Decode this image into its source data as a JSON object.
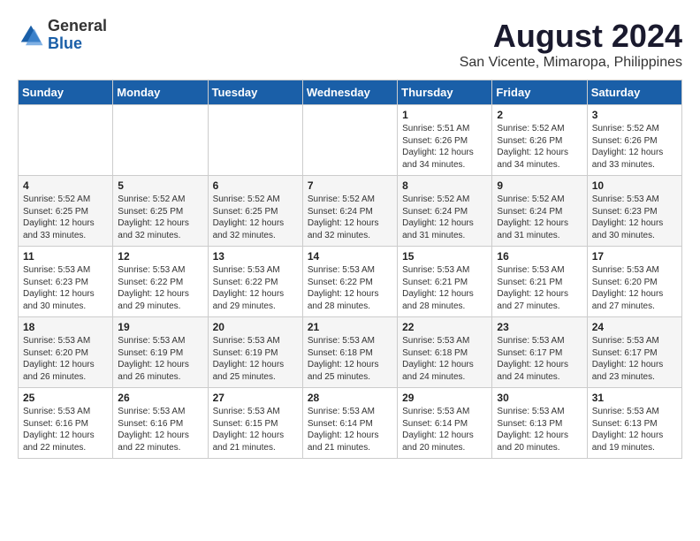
{
  "logo": {
    "general": "General",
    "blue": "Blue"
  },
  "title": "August 2024",
  "subtitle": "San Vicente, Mimaropa, Philippines",
  "headers": [
    "Sunday",
    "Monday",
    "Tuesday",
    "Wednesday",
    "Thursday",
    "Friday",
    "Saturday"
  ],
  "weeks": [
    [
      {
        "day": "",
        "content": ""
      },
      {
        "day": "",
        "content": ""
      },
      {
        "day": "",
        "content": ""
      },
      {
        "day": "",
        "content": ""
      },
      {
        "day": "1",
        "content": "Sunrise: 5:51 AM\nSunset: 6:26 PM\nDaylight: 12 hours\nand 34 minutes."
      },
      {
        "day": "2",
        "content": "Sunrise: 5:52 AM\nSunset: 6:26 PM\nDaylight: 12 hours\nand 34 minutes."
      },
      {
        "day": "3",
        "content": "Sunrise: 5:52 AM\nSunset: 6:26 PM\nDaylight: 12 hours\nand 33 minutes."
      }
    ],
    [
      {
        "day": "4",
        "content": "Sunrise: 5:52 AM\nSunset: 6:25 PM\nDaylight: 12 hours\nand 33 minutes."
      },
      {
        "day": "5",
        "content": "Sunrise: 5:52 AM\nSunset: 6:25 PM\nDaylight: 12 hours\nand 32 minutes."
      },
      {
        "day": "6",
        "content": "Sunrise: 5:52 AM\nSunset: 6:25 PM\nDaylight: 12 hours\nand 32 minutes."
      },
      {
        "day": "7",
        "content": "Sunrise: 5:52 AM\nSunset: 6:24 PM\nDaylight: 12 hours\nand 32 minutes."
      },
      {
        "day": "8",
        "content": "Sunrise: 5:52 AM\nSunset: 6:24 PM\nDaylight: 12 hours\nand 31 minutes."
      },
      {
        "day": "9",
        "content": "Sunrise: 5:52 AM\nSunset: 6:24 PM\nDaylight: 12 hours\nand 31 minutes."
      },
      {
        "day": "10",
        "content": "Sunrise: 5:53 AM\nSunset: 6:23 PM\nDaylight: 12 hours\nand 30 minutes."
      }
    ],
    [
      {
        "day": "11",
        "content": "Sunrise: 5:53 AM\nSunset: 6:23 PM\nDaylight: 12 hours\nand 30 minutes."
      },
      {
        "day": "12",
        "content": "Sunrise: 5:53 AM\nSunset: 6:22 PM\nDaylight: 12 hours\nand 29 minutes."
      },
      {
        "day": "13",
        "content": "Sunrise: 5:53 AM\nSunset: 6:22 PM\nDaylight: 12 hours\nand 29 minutes."
      },
      {
        "day": "14",
        "content": "Sunrise: 5:53 AM\nSunset: 6:22 PM\nDaylight: 12 hours\nand 28 minutes."
      },
      {
        "day": "15",
        "content": "Sunrise: 5:53 AM\nSunset: 6:21 PM\nDaylight: 12 hours\nand 28 minutes."
      },
      {
        "day": "16",
        "content": "Sunrise: 5:53 AM\nSunset: 6:21 PM\nDaylight: 12 hours\nand 27 minutes."
      },
      {
        "day": "17",
        "content": "Sunrise: 5:53 AM\nSunset: 6:20 PM\nDaylight: 12 hours\nand 27 minutes."
      }
    ],
    [
      {
        "day": "18",
        "content": "Sunrise: 5:53 AM\nSunset: 6:20 PM\nDaylight: 12 hours\nand 26 minutes."
      },
      {
        "day": "19",
        "content": "Sunrise: 5:53 AM\nSunset: 6:19 PM\nDaylight: 12 hours\nand 26 minutes."
      },
      {
        "day": "20",
        "content": "Sunrise: 5:53 AM\nSunset: 6:19 PM\nDaylight: 12 hours\nand 25 minutes."
      },
      {
        "day": "21",
        "content": "Sunrise: 5:53 AM\nSunset: 6:18 PM\nDaylight: 12 hours\nand 25 minutes."
      },
      {
        "day": "22",
        "content": "Sunrise: 5:53 AM\nSunset: 6:18 PM\nDaylight: 12 hours\nand 24 minutes."
      },
      {
        "day": "23",
        "content": "Sunrise: 5:53 AM\nSunset: 6:17 PM\nDaylight: 12 hours\nand 24 minutes."
      },
      {
        "day": "24",
        "content": "Sunrise: 5:53 AM\nSunset: 6:17 PM\nDaylight: 12 hours\nand 23 minutes."
      }
    ],
    [
      {
        "day": "25",
        "content": "Sunrise: 5:53 AM\nSunset: 6:16 PM\nDaylight: 12 hours\nand 22 minutes."
      },
      {
        "day": "26",
        "content": "Sunrise: 5:53 AM\nSunset: 6:16 PM\nDaylight: 12 hours\nand 22 minutes."
      },
      {
        "day": "27",
        "content": "Sunrise: 5:53 AM\nSunset: 6:15 PM\nDaylight: 12 hours\nand 21 minutes."
      },
      {
        "day": "28",
        "content": "Sunrise: 5:53 AM\nSunset: 6:14 PM\nDaylight: 12 hours\nand 21 minutes."
      },
      {
        "day": "29",
        "content": "Sunrise: 5:53 AM\nSunset: 6:14 PM\nDaylight: 12 hours\nand 20 minutes."
      },
      {
        "day": "30",
        "content": "Sunrise: 5:53 AM\nSunset: 6:13 PM\nDaylight: 12 hours\nand 20 minutes."
      },
      {
        "day": "31",
        "content": "Sunrise: 5:53 AM\nSunset: 6:13 PM\nDaylight: 12 hours\nand 19 minutes."
      }
    ]
  ]
}
